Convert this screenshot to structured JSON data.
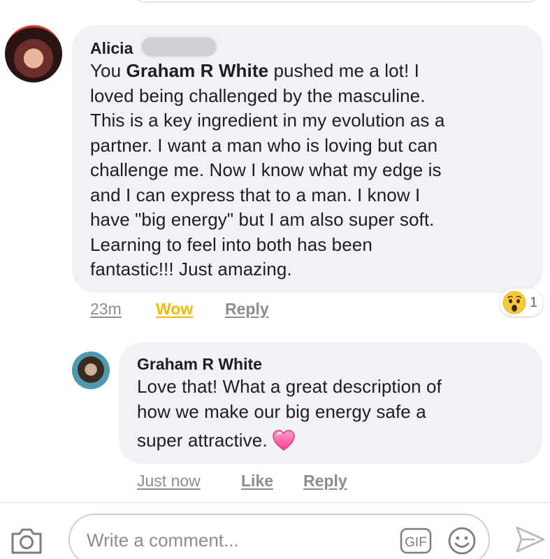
{
  "comments": [
    {
      "author": "Alicia",
      "text_lines": [
        [
          "You ",
          "Graham R White",
          " pushed me a lot! I"
        ],
        "loved being challenged by the masculine.",
        "This is a key ingredient in my evolution as a",
        "partner. I want a man who is loving but can",
        "challenge me. Now I know what my edge is",
        "and I can express that to a man. I know I",
        "have \"big energy\" but I am also super soft.",
        "Learning to feel into both has been",
        "fantastic!!! Just amazing."
      ],
      "timestamp": "23m",
      "reaction_label": "Wow",
      "reply_label": "Reply",
      "reaction_badge": {
        "icon": "wow-face-icon",
        "count": "1"
      }
    },
    {
      "author": "Graham R White",
      "text_lines": [
        "Love that!  What a great description of",
        "how we make our big energy safe a",
        "super attractive."
      ],
      "timestamp": "Just now",
      "like_label": "Like",
      "reply_label": "Reply",
      "trailing_icon": "pink-heart-icon"
    }
  ],
  "composer": {
    "placeholder": "Write a comment...",
    "gif_label": "GIF"
  },
  "icons": {
    "camera": "camera-icon",
    "emoji": "smiley-icon",
    "send": "send-icon"
  },
  "colors": {
    "bubble": "#f0f2f5",
    "wow_active": "#f0b90b",
    "meta_text": "#8a8d91",
    "heart": "#ff5fa2"
  }
}
